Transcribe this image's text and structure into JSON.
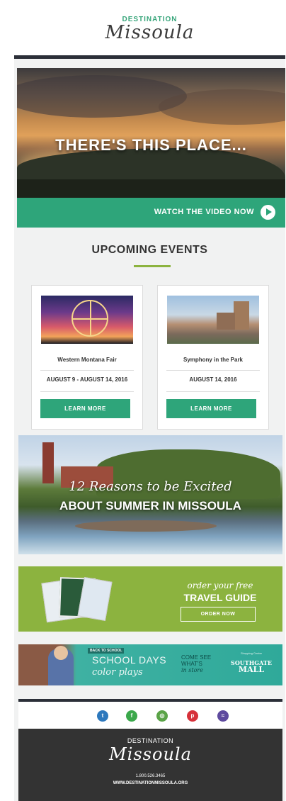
{
  "header": {
    "brand_small": "DESTINATION",
    "brand_script": "Missoula"
  },
  "hero": {
    "title": "THERE'S THIS PLACE...",
    "video_label": "WATCH THE VIDEO NOW",
    "play_icon": "play-circle-icon"
  },
  "events": {
    "title": "UPCOMING EVENTS",
    "items": [
      {
        "name": "Western Montana Fair",
        "date": "AUGUST 9 - AUGUST 14, 2016",
        "button": "LEARN MORE"
      },
      {
        "name": "Symphony in the Park",
        "date": "AUGUST 14, 2016",
        "button": "LEARN MORE"
      }
    ]
  },
  "summer": {
    "script": "12 Reasons to be Excited",
    "title": "ABOUT SUMMER IN MISSOULA"
  },
  "guide": {
    "script": "order your free",
    "title": "TRAVEL GUIDE",
    "button": "ORDER NOW"
  },
  "school_ad": {
    "tag": "BACK TO SCHOOL",
    "days": "SCHOOL DAYS",
    "plays": "color plays",
    "come_line1": "COME SEE",
    "come_line2": "WHAT'S",
    "come_line3": "in store",
    "mall_small": "Shopping Center",
    "mall_line1": "SOUTHGATE",
    "mall_line2": "MALL"
  },
  "social": {
    "icons": [
      "twitter-icon",
      "facebook-icon",
      "instagram-icon",
      "pinterest-icon",
      "rss-icon"
    ],
    "colors": {
      "twitter": "#2d78bd",
      "facebook": "#3ba84b",
      "instagram": "#5aa347",
      "pinterest": "#d6313a",
      "rss": "#5e4a9e"
    }
  },
  "footer": {
    "brand_small": "DESTINATION",
    "brand_script": "Missoula",
    "phone": "1.800.526.3465",
    "url": "WWW.DESTINATIONMISSOULA.ORG"
  },
  "colors": {
    "accent_green": "#2ea57a",
    "lime": "#8cb33f",
    "dark": "#333333",
    "navy_rule": "#2b2f38"
  }
}
